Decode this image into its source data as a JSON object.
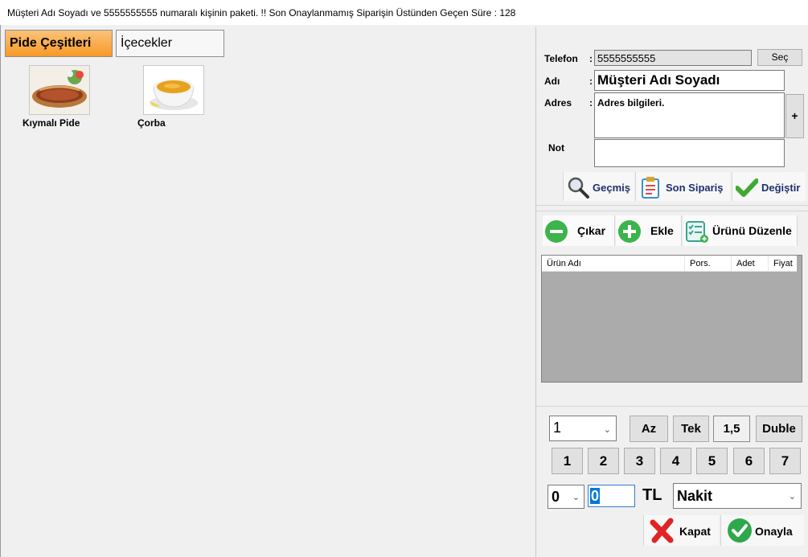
{
  "title_bar": {
    "text": "Müşteri Adı Soyadı ve 5555555555 numaralı kişinin paketi. !! Son Onaylanmamış Siparişin Üstünden Geçen Süre : 128"
  },
  "categories": [
    {
      "label": "Pide Çeşitleri",
      "active": true
    },
    {
      "label": "İçecekler",
      "active": false
    }
  ],
  "products": [
    {
      "label": "Kıymalı Pide",
      "icon": "pide-food-photo"
    },
    {
      "label": "Çorba",
      "icon": "soup-bowl-photo"
    }
  ],
  "customer": {
    "phone_label": "Telefon",
    "phone_value": "5555555555",
    "select_button": "Seç",
    "name_label": "Adı",
    "name_value": "Müşteri Adı Soyadı",
    "address_label": "Adres",
    "address_value": "Adres bilgileri.",
    "address_add_button": "+",
    "note_label": "Not",
    "note_value": "",
    "colon": ":"
  },
  "customer_actions": {
    "history": "Geçmiş",
    "last_order": "Son Sipariş",
    "change": "Değiştir"
  },
  "item_actions": {
    "remove": "Çıkar",
    "add": "Ekle",
    "edit": "Ürünü Düzenle"
  },
  "order_list": {
    "columns": [
      "Ürün Adı",
      "Pors.",
      "Adet",
      "Fiyat"
    ],
    "rows": []
  },
  "quantity": {
    "selected": "1",
    "portion_buttons": [
      "Az",
      "Tek",
      "1,5",
      "Duble"
    ],
    "number_buttons": [
      "1",
      "2",
      "3",
      "4",
      "5",
      "6",
      "7"
    ]
  },
  "payment": {
    "discount_selected": "0",
    "amount_value": "0",
    "currency": "TL",
    "method_selected": "Nakit"
  },
  "footer": {
    "close": "Kapat",
    "confirm": "Onayla"
  },
  "colors": {
    "active_tab_top": "#fbc27a",
    "active_tab_bottom": "#f79a26",
    "list_background": "#ababab",
    "confirm_green": "#2ea84a",
    "close_red": "#e02424",
    "add_green": "#3cb44b"
  }
}
